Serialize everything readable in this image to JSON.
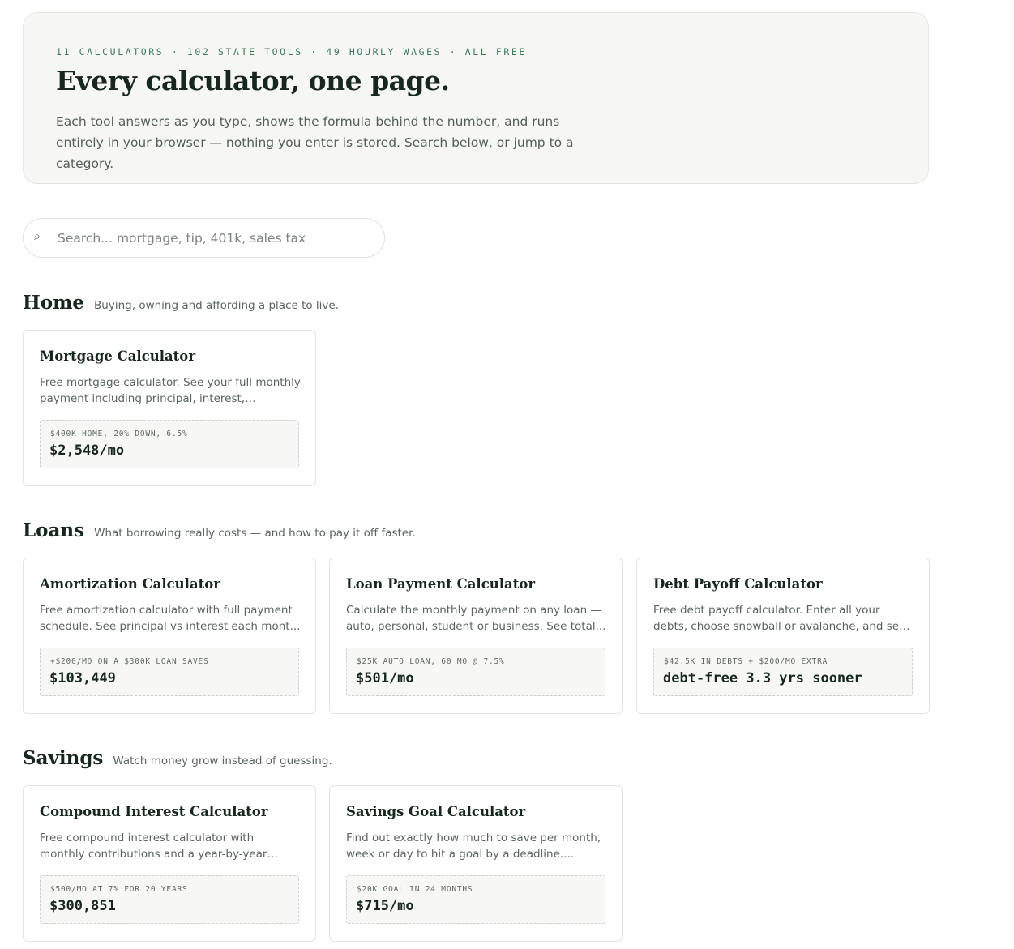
{
  "hero": {
    "kicker": "11 CALCULATORS · 102 STATE TOOLS · 49 HOURLY WAGES · ALL FREE",
    "title": "Every calculator, one page.",
    "description": "Each tool answers as you type, shows the formula behind the number, and runs entirely in your browser — nothing you enter is stored. Search below, or jump to a category."
  },
  "search": {
    "icon": "search-icon",
    "glyph": "⌕",
    "placeholder": "Search... mortgage, tip, 401k, sales tax",
    "value": ""
  },
  "sections": [
    {
      "title": "Home",
      "subtitle": "Buying, owning and affording a place to live.",
      "cards": [
        {
          "title": "Mortgage Calculator",
          "description": "Free mortgage calculator. See your full monthly payment including principal, interest, property...",
          "example_label": "$400K HOME, 20% DOWN, 6.5%",
          "example_value": "$2,548/mo"
        }
      ]
    },
    {
      "title": "Loans",
      "subtitle": "What borrowing really costs — and how to pay it off faster.",
      "cards": [
        {
          "title": "Amortization Calculator",
          "description": "Free amortization calculator with full payment schedule. See principal vs interest each mont...",
          "example_label": "+$200/MO ON A $300K LOAN SAVES",
          "example_value": "$103,449"
        },
        {
          "title": "Loan Payment Calculator",
          "description": "Calculate the monthly payment on any loan — auto, personal, student or business. See total...",
          "example_label": "$25K AUTO LOAN, 60 MO @ 7.5%",
          "example_value": "$501/mo"
        },
        {
          "title": "Debt Payoff Calculator",
          "description": "Free debt payoff calculator. Enter all your debts, choose snowball or avalanche, and see your...",
          "example_label": "$42.5K IN DEBTS + $200/MO EXTRA",
          "example_value": "debt-free 3.3 yrs sooner"
        }
      ]
    },
    {
      "title": "Savings",
      "subtitle": "Watch money grow instead of guessing.",
      "cards": [
        {
          "title": "Compound Interest Calculator",
          "description": "Free compound interest calculator with monthly contributions and a year-by-year table. See ho...",
          "example_label": "$500/MO AT 7% FOR 20 YEARS",
          "example_value": "$300,851"
        },
        {
          "title": "Savings Goal Calculator",
          "description": "Find out exactly how much to save per month, week or day to hit a goal by a deadline....",
          "example_label": "$20K GOAL IN 24 MONTHS",
          "example_value": "$715/mo"
        }
      ]
    }
  ],
  "colors": {
    "accent_green": "#3d7a57",
    "heading": "#17271e",
    "hero_bg": "#f6f7f4"
  }
}
